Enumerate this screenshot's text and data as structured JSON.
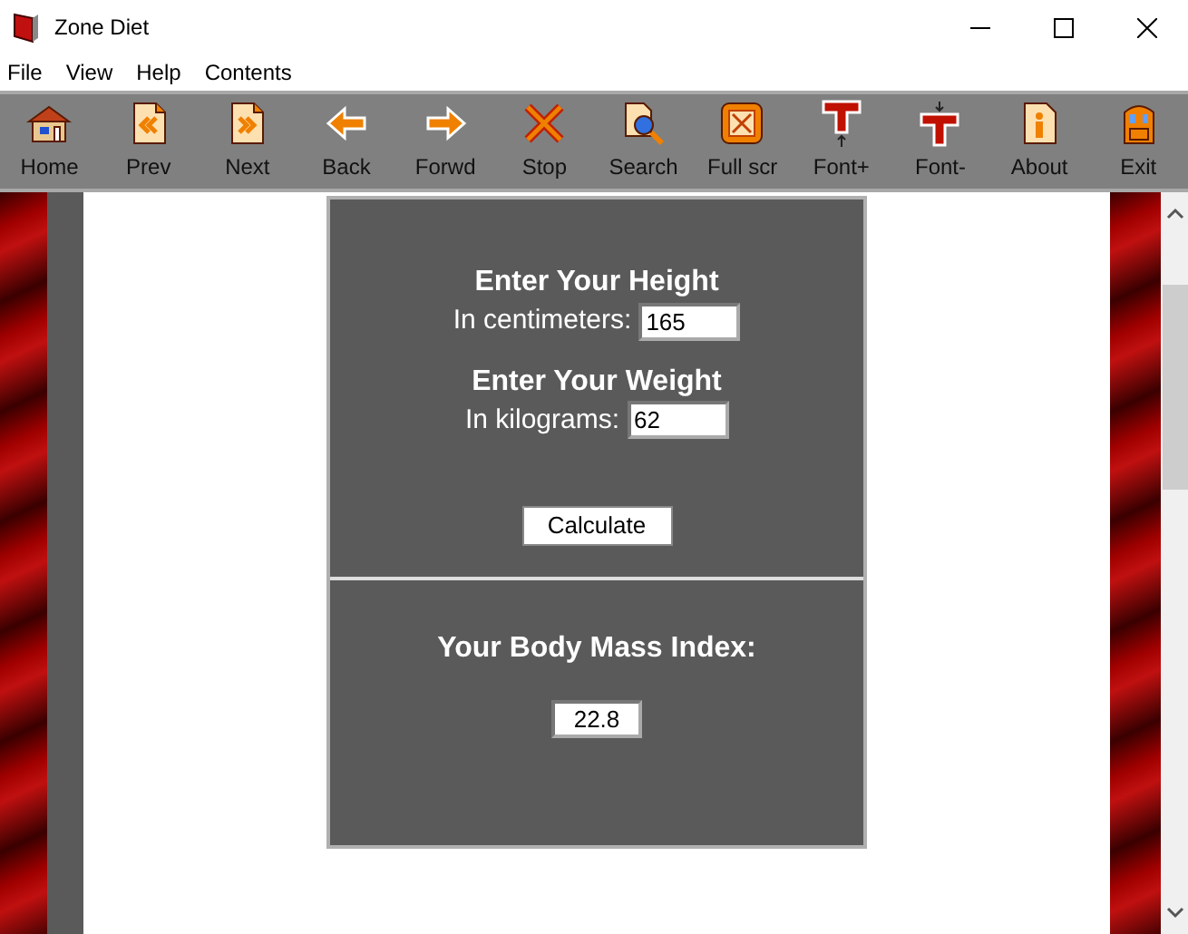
{
  "window": {
    "title": "Zone Diet"
  },
  "menu": [
    "File",
    "View",
    "Help",
    "Contents"
  ],
  "toolbar": [
    {
      "label": "Home",
      "kind": "home"
    },
    {
      "label": "Prev",
      "kind": "prev"
    },
    {
      "label": "Next",
      "kind": "next"
    },
    {
      "label": "Back",
      "kind": "back"
    },
    {
      "label": "Forwd",
      "kind": "forward"
    },
    {
      "label": "Stop",
      "kind": "stop"
    },
    {
      "label": "Search",
      "kind": "search"
    },
    {
      "label": "Full scr",
      "kind": "fullscreen"
    },
    {
      "label": "Font+",
      "kind": "fontup"
    },
    {
      "label": "Font-",
      "kind": "fontdown"
    },
    {
      "label": "About",
      "kind": "about"
    },
    {
      "label": "Exit",
      "kind": "exit"
    }
  ],
  "form": {
    "fields": [
      {
        "heading": "Enter Your Height",
        "label": "In centimeters:",
        "value": "165"
      },
      {
        "heading": "Enter Your Weight",
        "label": "In kilograms:",
        "value": "62"
      }
    ],
    "button": "Calculate",
    "result_heading": "Your Body Mass Index:",
    "result_value": "22.8"
  }
}
